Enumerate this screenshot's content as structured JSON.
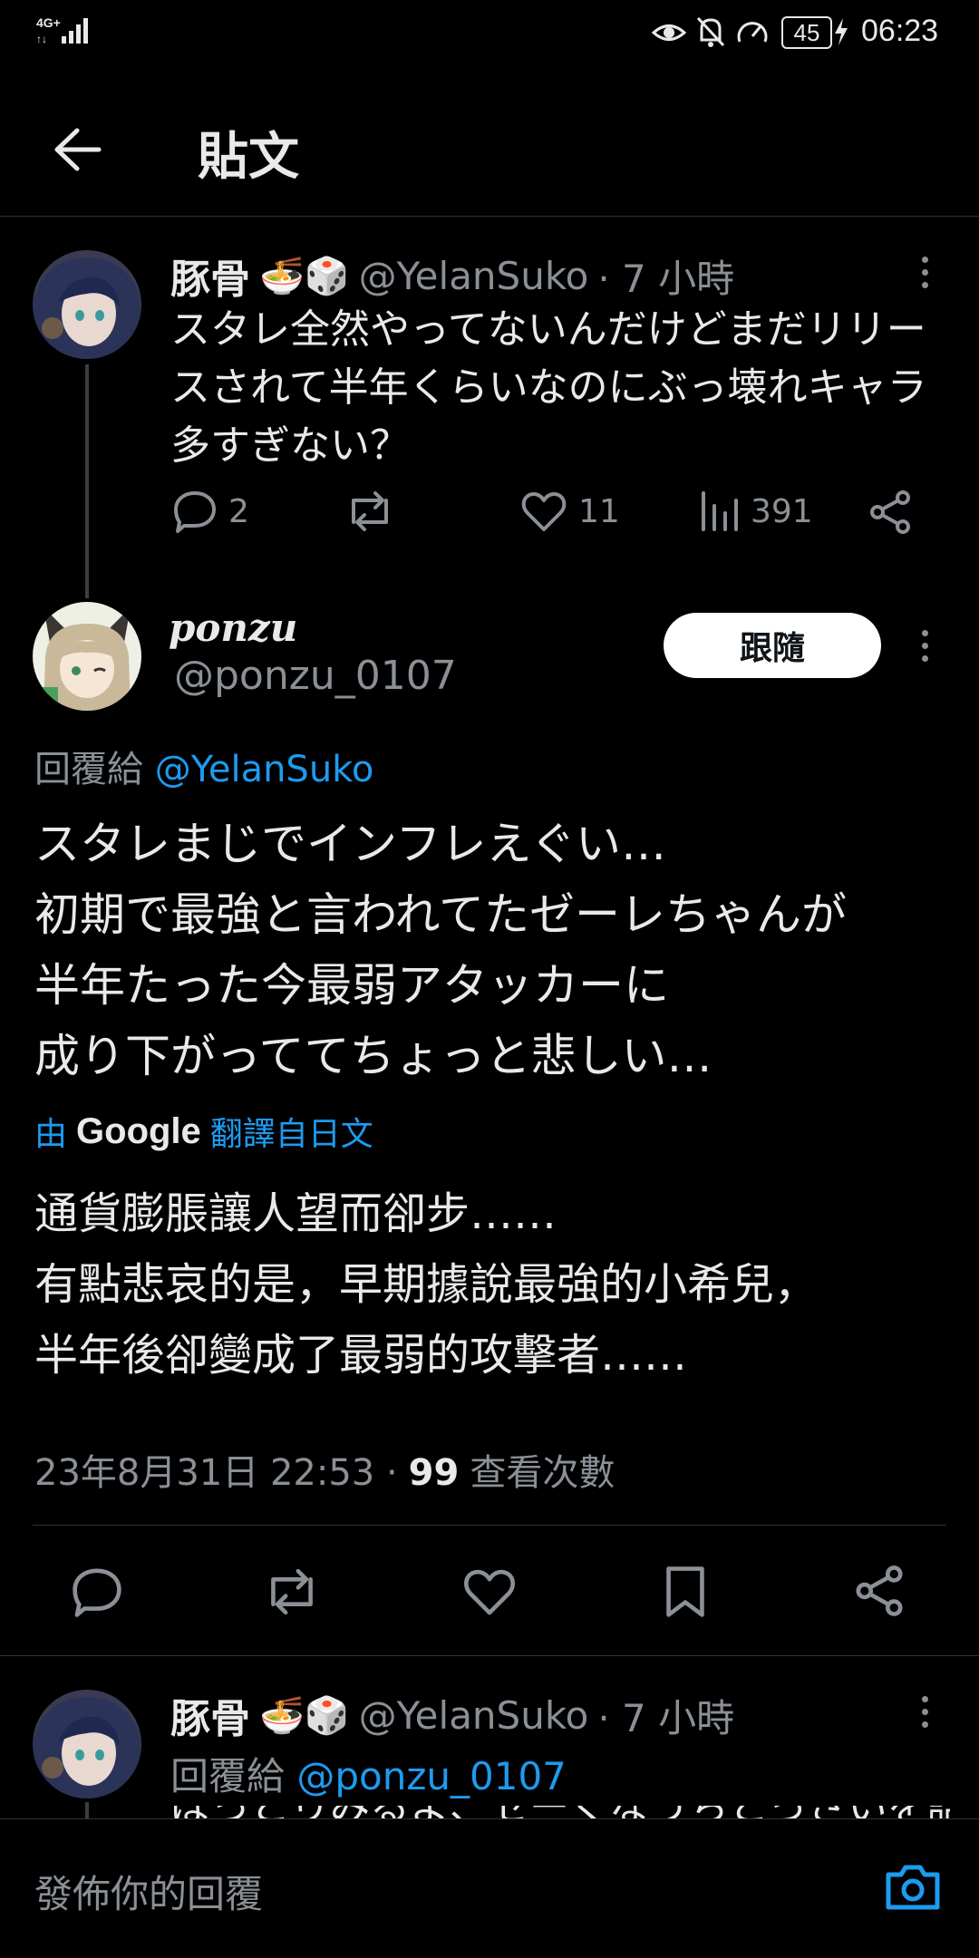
{
  "status_bar": {
    "network": "4G⁺",
    "battery": "45",
    "time": "06:23"
  },
  "header": {
    "title": "貼文"
  },
  "parent_tweet": {
    "name": "豚骨",
    "name_emoji": "🍜🎲",
    "handle": "@YelanSuko",
    "time": "· 7 小時",
    "text": "スタレ全然やってないんだけどまだリリー\nスされて半年くらいなのにぶっ壊れキャラ\n多すぎない？",
    "replies": "2",
    "likes": "11",
    "views": "391"
  },
  "main_tweet": {
    "name": "ponzu",
    "handle": "@ponzu_0107",
    "follow_label": "跟隨",
    "reply_to_label": "回覆給",
    "reply_to_handle": "@YelanSuko",
    "text": "スタレまじでインフレえぐい…\n初期で最強と言われてたゼーレちゃんが\n半年たった今最弱アタッカーに\n成り下がっててちょっと悲しい…",
    "translate_prefix": "由",
    "translate_brand": "Google",
    "translate_suffix": "翻譯自日文",
    "translation": "通貨膨脹讓人望而卻步……\n有點悲哀的是，早期據說最強的小希兒，\n半年後卻變成了最弱的攻擊者……",
    "timestamp": "23年8月31日 22:53 ·",
    "view_count": "99",
    "view_label": "查看次數"
  },
  "reply_tweet": {
    "name": "豚骨",
    "name_emoji": "🍜🎲",
    "handle": "@YelanSuko",
    "time": "· 7 小時",
    "reply_to_label": "回覆給",
    "reply_to_handle": "@ponzu_0107",
    "text_partial": "ぱっとりみるよ、セーくなうちとっさいを話る筈"
  },
  "reply_composer": {
    "placeholder": "發佈你的回覆"
  },
  "colors": {
    "accent": "#1d9bf0",
    "background": "#000000",
    "muted": "#8b9096"
  }
}
